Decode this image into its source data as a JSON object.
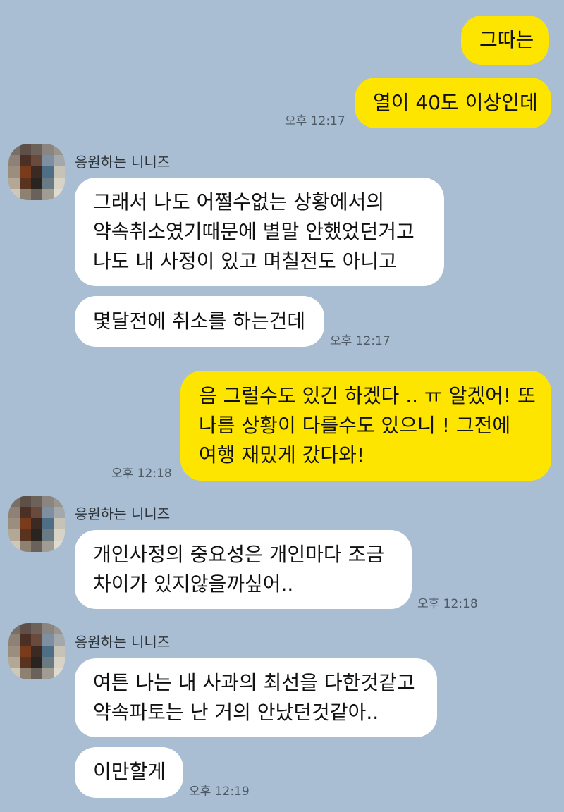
{
  "sender_name": "응원하는 니니즈",
  "avatar_icon": "pixelated-profile-icon",
  "messages": [
    {
      "from": "me",
      "lines": [
        "그따는"
      ]
    },
    {
      "from": "me",
      "lines": [
        "열이 40도 이상인데"
      ],
      "time": "오후 12:17"
    },
    {
      "from": "them",
      "lines": [
        "그래서 나도 어쩔수없는 상황에서의",
        "약속취소였기때문에 별말 안했었던거고",
        "나도 내 사정이 있고 며칠전도 아니고"
      ]
    },
    {
      "from": "them",
      "lines": [
        "몇달전에 취소를 하는건데"
      ],
      "time": "오후 12:17"
    },
    {
      "from": "me",
      "lines": [
        "음 그럴수도 있긴 하겠다 .. ㅠ 알겠어! 또",
        "나름 상황이 다를수도 있으니 ! 그전에",
        "여행 재밌게 갔다와!"
      ],
      "time": "오후 12:18"
    },
    {
      "from": "them",
      "lines": [
        "개인사정의 중요성은 개인마다 조금",
        "차이가 있지않을까싶어.."
      ],
      "time": "오후 12:18"
    },
    {
      "from": "them",
      "lines": [
        "여튼 나는 내 사과의 최선을 다한것같고",
        "약속파토는 난 거의 안났던것같아.."
      ]
    },
    {
      "from": "them",
      "lines": [
        "이만할게"
      ],
      "time": "오후 12:19"
    }
  ],
  "colors": {
    "background": "#a9bed3",
    "my_bubble": "#fee500",
    "their_bubble": "#ffffff"
  }
}
